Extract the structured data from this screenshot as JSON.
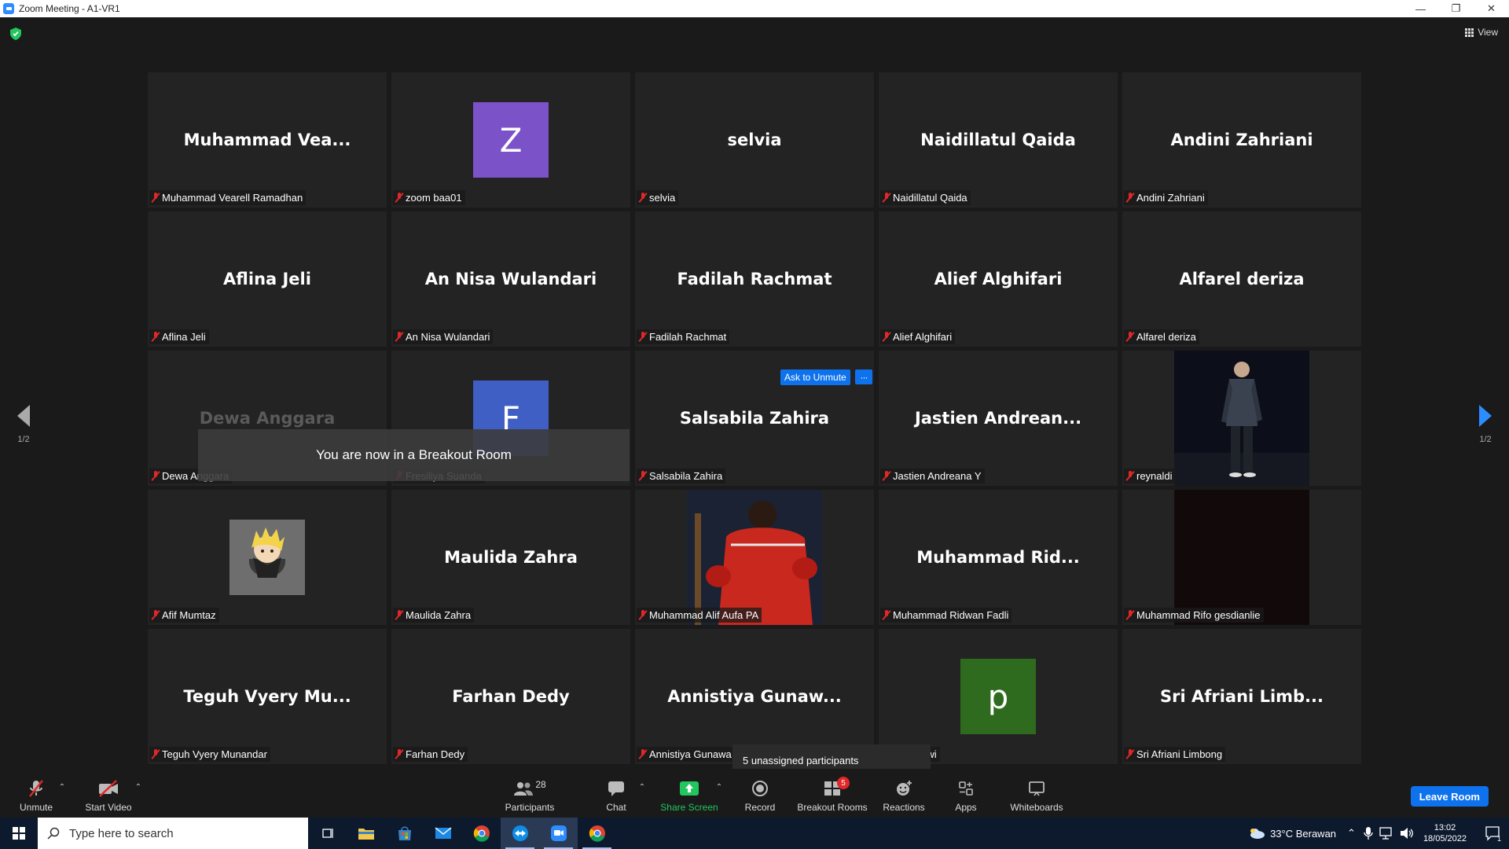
{
  "window": {
    "title": "Zoom Meeting - A1-VR1",
    "controls": [
      "—",
      "❐",
      "✕"
    ]
  },
  "top": {
    "view_label": "View"
  },
  "pagination": {
    "left": "1/2",
    "right": "1/2"
  },
  "overlays": {
    "ask_to_unmute": "Ask to Unmute",
    "more": "···",
    "breakout_toast": "You are now in a Breakout Room",
    "unassigned_tip": "5 unassigned participants"
  },
  "tiles": [
    {
      "display": "Muhammad  Vea...",
      "label": "Muhammad Vearell Ramadhan",
      "kind": "name"
    },
    {
      "display": "Z",
      "label": "zoom baa01",
      "kind": "letter",
      "color": "#7b52c8"
    },
    {
      "display": "selvia",
      "label": "selvia",
      "kind": "name"
    },
    {
      "display": "Naidillatul Qaida",
      "label": "Naidillatul Qaida",
      "kind": "name"
    },
    {
      "display": "Andini Zahriani",
      "label": "Andini Zahriani",
      "kind": "name"
    },
    {
      "display": "Aflina Jeli",
      "label": "Aflina Jeli",
      "kind": "name"
    },
    {
      "display": "An Nisa Wulandari",
      "label": "An Nisa Wulandari",
      "kind": "name"
    },
    {
      "display": "Fadilah Rachmat",
      "label": "Fadilah Rachmat",
      "kind": "name"
    },
    {
      "display": "Alief Alghifari",
      "label": "Alief Alghifari",
      "kind": "name"
    },
    {
      "display": "Alfarel deriza",
      "label": "Alfarel deriza",
      "kind": "name"
    },
    {
      "display": "Dewa Anggara",
      "label": "Dewa Anggara",
      "kind": "name"
    },
    {
      "display": "F",
      "label": "Fresiliya Suanda",
      "kind": "letter",
      "color": "#3f5fc4"
    },
    {
      "display": "Salsabila Zahira",
      "label": "Salsabila Zahira",
      "kind": "name"
    },
    {
      "display": "Jastien  Andrean...",
      "label": "Jastien Andreana Y",
      "kind": "name"
    },
    {
      "display": "",
      "label": "reynaldi",
      "kind": "photo-night"
    },
    {
      "display": "",
      "label": "Afif Mumtaz",
      "kind": "anime"
    },
    {
      "display": "Maulida Zahra",
      "label": "Maulida Zahra",
      "kind": "name"
    },
    {
      "display": "",
      "label": "Muhammad Alif Aufa PA",
      "kind": "photo-boxer"
    },
    {
      "display": "Muhammad  Rid...",
      "label": "Muhammad Ridwan Fadli",
      "kind": "name"
    },
    {
      "display": "",
      "label": "Muhammad Rifo gesdianlie",
      "kind": "photo-dark"
    },
    {
      "display": "Teguh Vyery Mu...",
      "label": "Teguh Vyery Munandar",
      "kind": "name"
    },
    {
      "display": "Farhan Dedy",
      "label": "Farhan Dedy",
      "kind": "name"
    },
    {
      "display": "Annistiya  Gunaw...",
      "label": "Annistiya Gunawa",
      "kind": "name"
    },
    {
      "display": "p",
      "label": "nggadewi",
      "kind": "letter",
      "color": "#2f6b1e"
    },
    {
      "display": "Sri Afriani Limb...",
      "label": "Sri Afriani Limbong",
      "kind": "name"
    }
  ],
  "toolbar": {
    "unmute": "Unmute",
    "start_video": "Start Video",
    "participants": "Participants",
    "participants_count": "28",
    "chat": "Chat",
    "share_screen": "Share Screen",
    "record": "Record",
    "breakout_rooms": "Breakout Rooms",
    "breakout_badge": "5",
    "reactions": "Reactions",
    "apps": "Apps",
    "whiteboards": "Whiteboards",
    "leave": "Leave Room"
  },
  "taskbar": {
    "search_placeholder": "Type here to search",
    "weather": "33°C  Berawan",
    "time": "13:02",
    "date": "18/05/2022",
    "notification_count": "1"
  },
  "colors": {
    "accent": "#0e72ed",
    "muted_mic": "#e02828",
    "share_green": "#22c55e",
    "badge_red": "#e02828"
  }
}
